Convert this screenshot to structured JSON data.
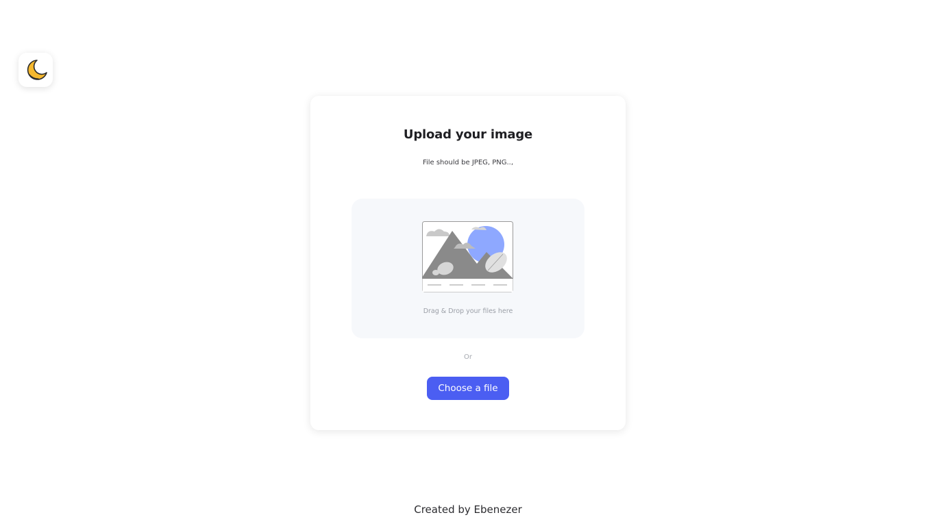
{
  "theme_toggle": {
    "icon": "moon-icon",
    "color": "#f5b82e"
  },
  "upload_card": {
    "title": "Upload your image",
    "subtitle": "File should be JPEG, PNG..,",
    "dropzone": {
      "icon": "image-placeholder-icon",
      "text": "Drag & Drop your files here"
    },
    "or_label": "Or",
    "choose_button_label": "Choose a file"
  },
  "footer": {
    "credit": "Created by Ebenezer"
  },
  "colors": {
    "accent": "#4b5ef2",
    "dropzone_bg": "#f6f8fb",
    "illustration_sun": "#8ea8ff",
    "illustration_mountain": "#8a8a8a"
  }
}
